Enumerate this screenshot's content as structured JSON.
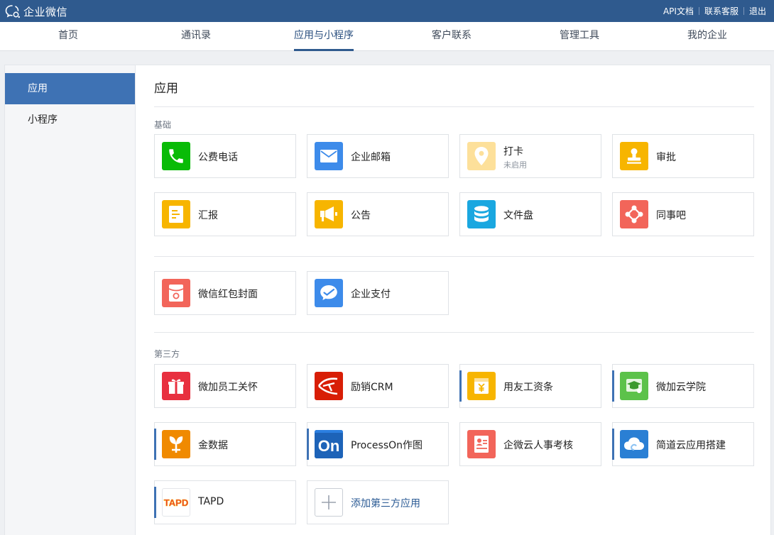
{
  "brand": "企业微信",
  "top_links": [
    "API文档",
    "联系客服",
    "退出"
  ],
  "nav": [
    {
      "label": "首页"
    },
    {
      "label": "通讯录"
    },
    {
      "label": "应用与小程序",
      "active": true
    },
    {
      "label": "客户联系"
    },
    {
      "label": "管理工具"
    },
    {
      "label": "我的企业"
    }
  ],
  "sidebar": [
    {
      "label": "应用",
      "active": true
    },
    {
      "label": "小程序"
    }
  ],
  "page_title": "应用",
  "sections": {
    "basic": "基础",
    "third_party": "第三方"
  },
  "basic_apps": [
    {
      "name": "公费电话",
      "icon": "phone-icon",
      "color": "#09bb07"
    },
    {
      "name": "企业邮箱",
      "icon": "mail-icon",
      "color": "#3d8bea"
    },
    {
      "name": "打卡",
      "sub": "未启用",
      "icon": "location-icon",
      "color": "#fde09a"
    },
    {
      "name": "审批",
      "icon": "stamp-icon",
      "color": "#f7b500"
    },
    {
      "name": "汇报",
      "icon": "report-icon",
      "color": "#f7b500"
    },
    {
      "name": "公告",
      "icon": "megaphone-icon",
      "color": "#f7b500"
    },
    {
      "name": "文件盘",
      "icon": "database-icon",
      "color": "#1aa7e0"
    },
    {
      "name": "同事吧",
      "icon": "share-nodes-icon",
      "color": "#f2655a"
    }
  ],
  "extra_apps": [
    {
      "name": "微信红包封面",
      "icon": "red-envelope-icon",
      "color": "#f2655a"
    },
    {
      "name": "企业支付",
      "icon": "payment-icon",
      "color": "#3d8bea"
    }
  ],
  "third_party_apps": [
    {
      "name": "微加员工关怀",
      "icon": "gift-icon",
      "color": "#e8303f"
    },
    {
      "name": "励销CRM",
      "icon": "crm-icon",
      "color": "#d81e06"
    },
    {
      "name": "用友工资条",
      "icon": "payslip-icon",
      "color": "#f7b500"
    },
    {
      "name": "微加云学院",
      "icon": "graduation-icon",
      "color": "#5cc24a"
    },
    {
      "name": "金数据",
      "icon": "jinshuju-icon",
      "color": "#f08a00"
    },
    {
      "name": "ProcessOn作图",
      "icon": "processon-icon",
      "color": "#1d63b8",
      "logo_text": "On"
    },
    {
      "name": "企微云人事考核",
      "icon": "hr-card-icon",
      "color": "#f2655a"
    },
    {
      "name": "简道云应用搭建",
      "icon": "cloud-icon",
      "color": "#2a7fd4"
    },
    {
      "name": "TAPD",
      "icon": "tapd-logo-icon",
      "color": "#ffffff",
      "logo_text": "TAPD"
    }
  ],
  "add_app_label": "添加第三方应用"
}
